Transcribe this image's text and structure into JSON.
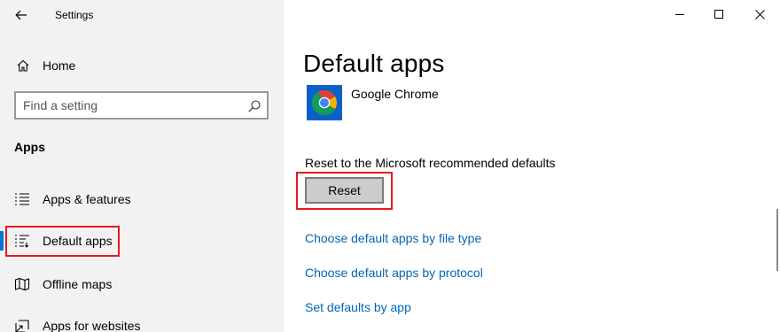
{
  "window": {
    "title": "Settings",
    "controls": [
      "minimize",
      "maximize",
      "close"
    ]
  },
  "sidebar": {
    "home_label": "Home",
    "search": {
      "placeholder": "Find a setting"
    },
    "section_label": "Apps",
    "items": [
      {
        "label": "Apps & features",
        "icon": "list-icon"
      },
      {
        "label": "Default apps",
        "icon": "default-apps-icon",
        "active": true
      },
      {
        "label": "Offline maps",
        "icon": "map-icon"
      },
      {
        "label": "Apps for websites",
        "icon": "open-in-app-icon"
      }
    ]
  },
  "main": {
    "title": "Default apps",
    "current_browser": {
      "name": "Google Chrome",
      "icon": "chrome-icon"
    },
    "reset": {
      "caption": "Reset to the Microsoft recommended defaults",
      "button_label": "Reset"
    },
    "links": [
      "Choose default apps by file type",
      "Choose default apps by protocol",
      "Set defaults by app"
    ]
  },
  "colors": {
    "sidebar_bg": "#f2f2f2",
    "accent": "#0078d7",
    "link": "#0067b8",
    "highlight": "#e8191c",
    "button_bg": "#cccccc"
  }
}
